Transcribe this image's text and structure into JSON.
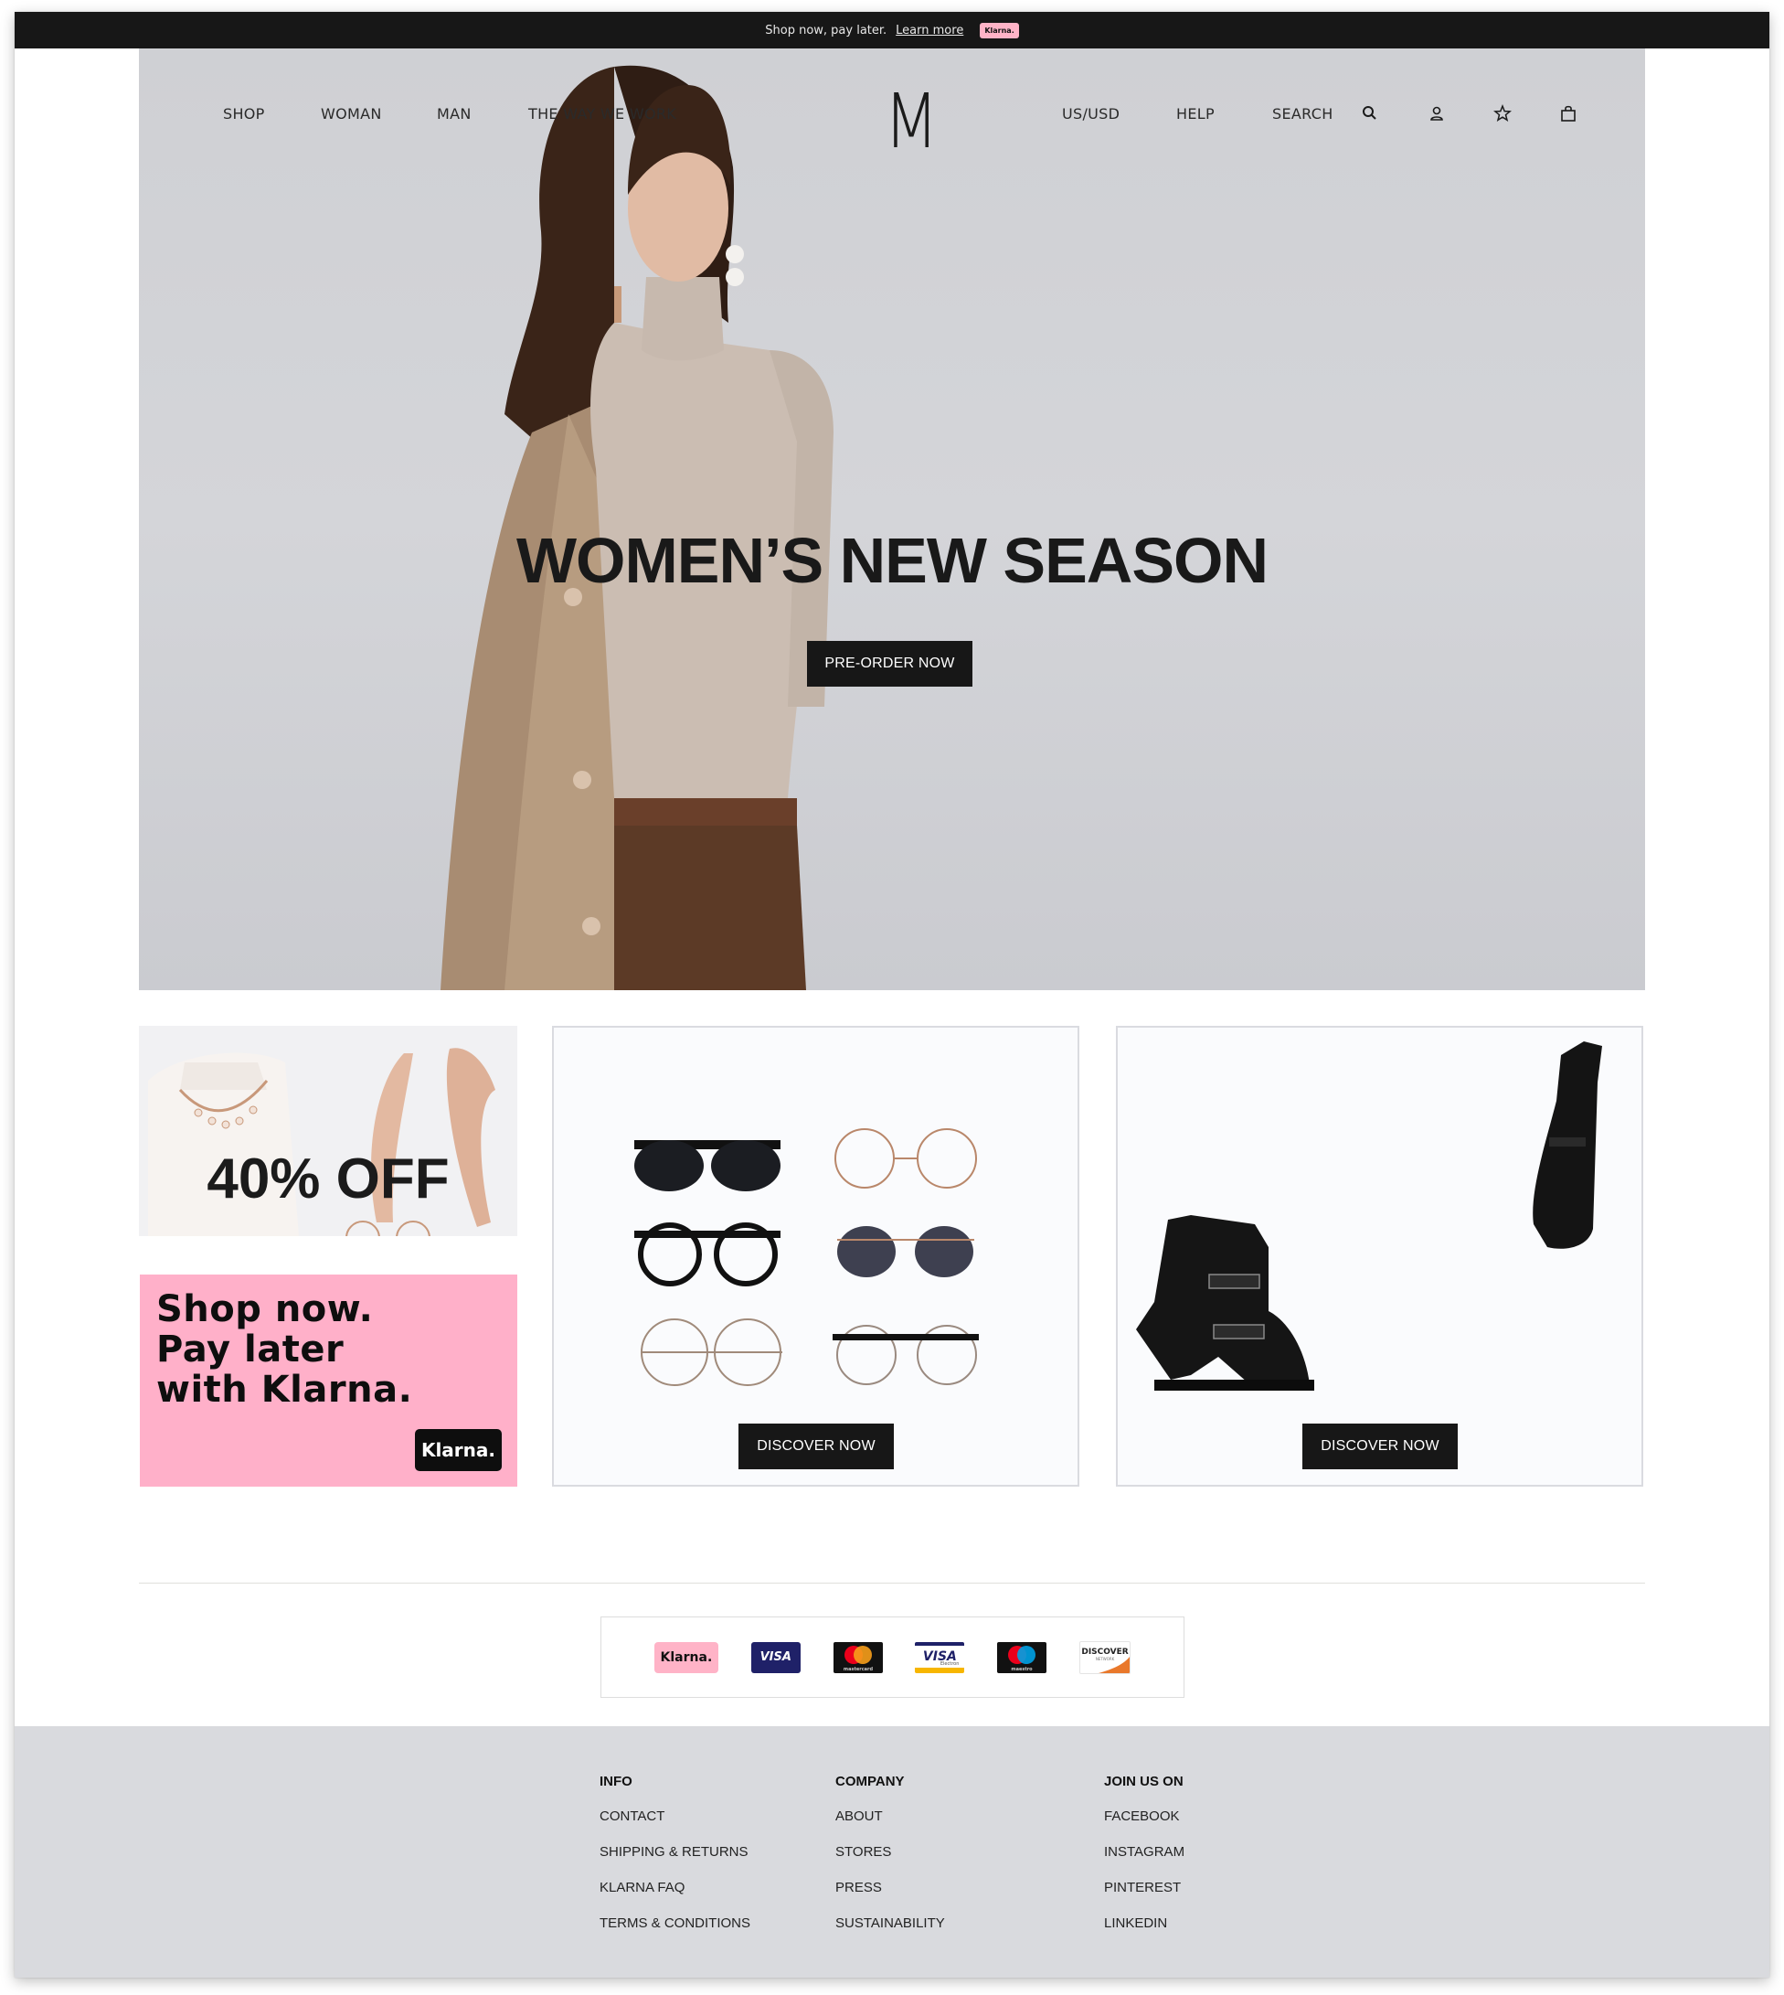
{
  "announcement": {
    "text": "Shop now, pay later.",
    "link": "Learn more",
    "badge": "Klarna."
  },
  "header": {
    "logo": "M",
    "nav_left": [
      "SHOP",
      "WOMAN",
      "MAN",
      "THE WAY WE WORK"
    ],
    "nav_right": [
      "US/USD",
      "HELP",
      "SEARCH"
    ],
    "icons": [
      "search-icon",
      "account-icon",
      "wishlist-star-icon",
      "shopping-bag-icon"
    ]
  },
  "hero": {
    "title": "WOMEN’S NEW SEASON",
    "cta": "PRE-ORDER NOW",
    "background": "#d1d2d6"
  },
  "promos": {
    "sale": {
      "text": "40% OFF"
    },
    "klarna": {
      "text": "Shop now.\nPay later\nwith Klarna.",
      "logo": "Klarna.",
      "color": "#ffb0c9"
    },
    "eyewear": {
      "cta": "DISCOVER NOW"
    },
    "boots": {
      "cta": "DISCOVER NOW"
    }
  },
  "payments": [
    {
      "name": "Klarna",
      "label": "Klarna."
    },
    {
      "name": "Visa",
      "label": "VISA"
    },
    {
      "name": "Mastercard",
      "label": "mastercard"
    },
    {
      "name": "Visa Electron",
      "label": "VISA",
      "sub": "Electron"
    },
    {
      "name": "Maestro",
      "label": "maestro"
    },
    {
      "name": "Discover",
      "label": "DISCOVER",
      "sub": "NETWORK"
    }
  ],
  "footer": {
    "columns": [
      {
        "heading": "INFO",
        "links": [
          "CONTACT",
          "SHIPPING & RETURNS",
          "KLARNA FAQ",
          "TERMS & CONDITIONS"
        ]
      },
      {
        "heading": "COMPANY",
        "links": [
          "ABOUT",
          "STORES",
          "PRESS",
          "SUSTAINABILITY"
        ]
      },
      {
        "heading": "JOIN US ON",
        "links": [
          "FACEBOOK",
          "INSTAGRAM",
          "PINTEREST",
          "LINKEDIN"
        ]
      }
    ]
  },
  "colors": {
    "dark": "#171717",
    "footer_bg": "#d9dade",
    "klarna_pink": "#ffb3c7"
  }
}
